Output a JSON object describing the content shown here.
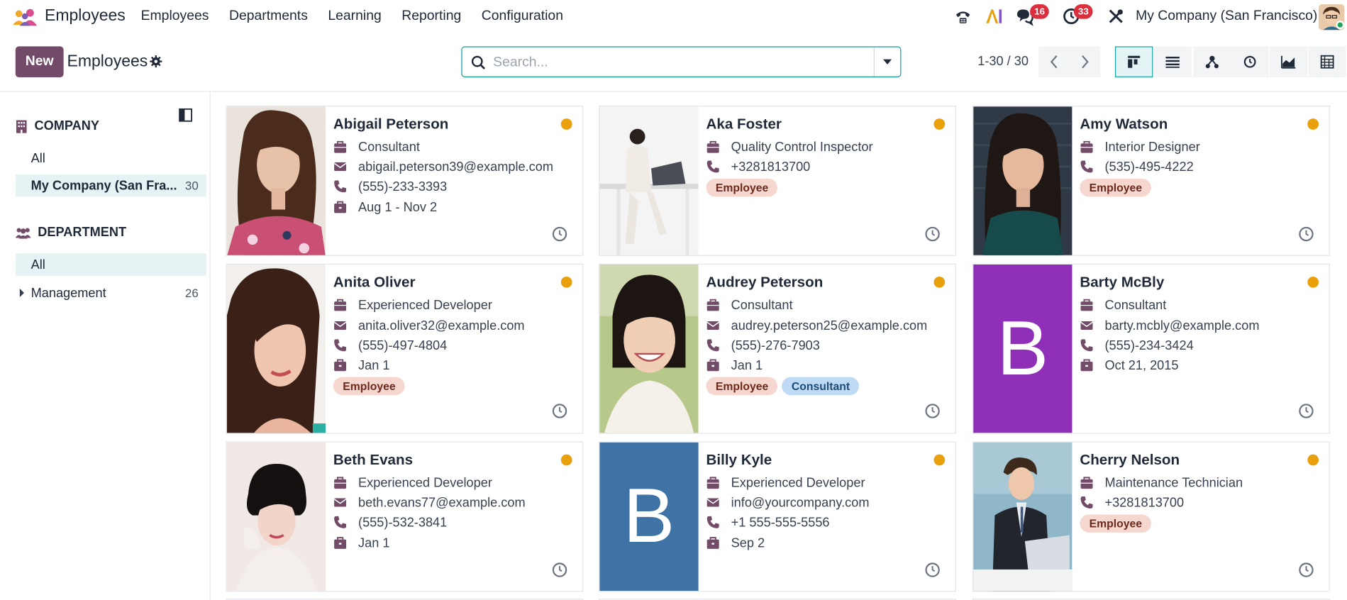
{
  "app": {
    "name": "Employees"
  },
  "menu": [
    "Employees",
    "Departments",
    "Learning",
    "Reporting",
    "Configuration"
  ],
  "systray": {
    "messages_count": "16",
    "activities_count": "33",
    "company": "My Company (San Francisco)"
  },
  "control": {
    "new_label": "New",
    "breadcrumb": "Employees",
    "search_placeholder": "Search...",
    "pager": "1-30 / 30"
  },
  "views": [
    "kanban-view",
    "list-view",
    "hierarchy-view",
    "activity-view",
    "graph-view",
    "pivot-view"
  ],
  "sidebar": {
    "company_title": "COMPANY",
    "company_items": [
      {
        "label": "All",
        "count": ""
      },
      {
        "label": "My Company (San Fra...",
        "count": "30"
      }
    ],
    "department_title": "DEPARTMENT",
    "department_items": [
      {
        "label": "All",
        "count": ""
      },
      {
        "label": "Management",
        "count": "26"
      }
    ]
  },
  "employees": [
    {
      "name": "Abigail Peterson",
      "job": "Consultant",
      "email": "abigail.peterson39@example.com",
      "phone": "(555)-233-3393",
      "dates": "Aug 1 - Nov 2",
      "tags": []
    },
    {
      "name": "Aka Foster",
      "job": "Quality Control Inspector",
      "email": "",
      "phone": "+3281813700",
      "dates": "",
      "tags": [
        "Employee"
      ]
    },
    {
      "name": "Amy Watson",
      "job": "Interior Designer",
      "email": "",
      "phone": "(535)-495-4222",
      "dates": "",
      "tags": [
        "Employee"
      ]
    },
    {
      "name": "Anita Oliver",
      "job": "Experienced Developer",
      "email": "anita.oliver32@example.com",
      "phone": "(555)-497-4804",
      "dates": "Jan 1",
      "tags": [
        "Employee"
      ]
    },
    {
      "name": "Audrey Peterson",
      "job": "Consultant",
      "email": "audrey.peterson25@example.com",
      "phone": "(555)-276-7903",
      "dates": "Jan 1",
      "tags": [
        "Employee",
        "Consultant"
      ]
    },
    {
      "name": "Barty McBly",
      "job": "Consultant",
      "email": "barty.mcbly@example.com",
      "phone": "(555)-234-3424",
      "dates": "Oct 21, 2015",
      "tags": [],
      "avatar_letter": "B",
      "avatar_color": "#8f2fb8"
    },
    {
      "name": "Beth Evans",
      "job": "Experienced Developer",
      "email": "beth.evans77@example.com",
      "phone": "(555)-532-3841",
      "dates": "Jan 1",
      "tags": []
    },
    {
      "name": "Billy Kyle",
      "job": "Experienced Developer",
      "email": "info@yourcompany.com",
      "phone": "+1 555-555-5556",
      "dates": "Sep 2",
      "tags": [],
      "avatar_letter": "B",
      "avatar_color": "#3f73a5"
    },
    {
      "name": "Cherry Nelson",
      "job": "Maintenance Technician",
      "email": "",
      "phone": "+3281813700",
      "dates": "",
      "tags": [
        "Employee"
      ]
    }
  ],
  "colors": {
    "brand": "#714b67",
    "accent": "#0b9e9e",
    "status": "#e9a00d"
  }
}
